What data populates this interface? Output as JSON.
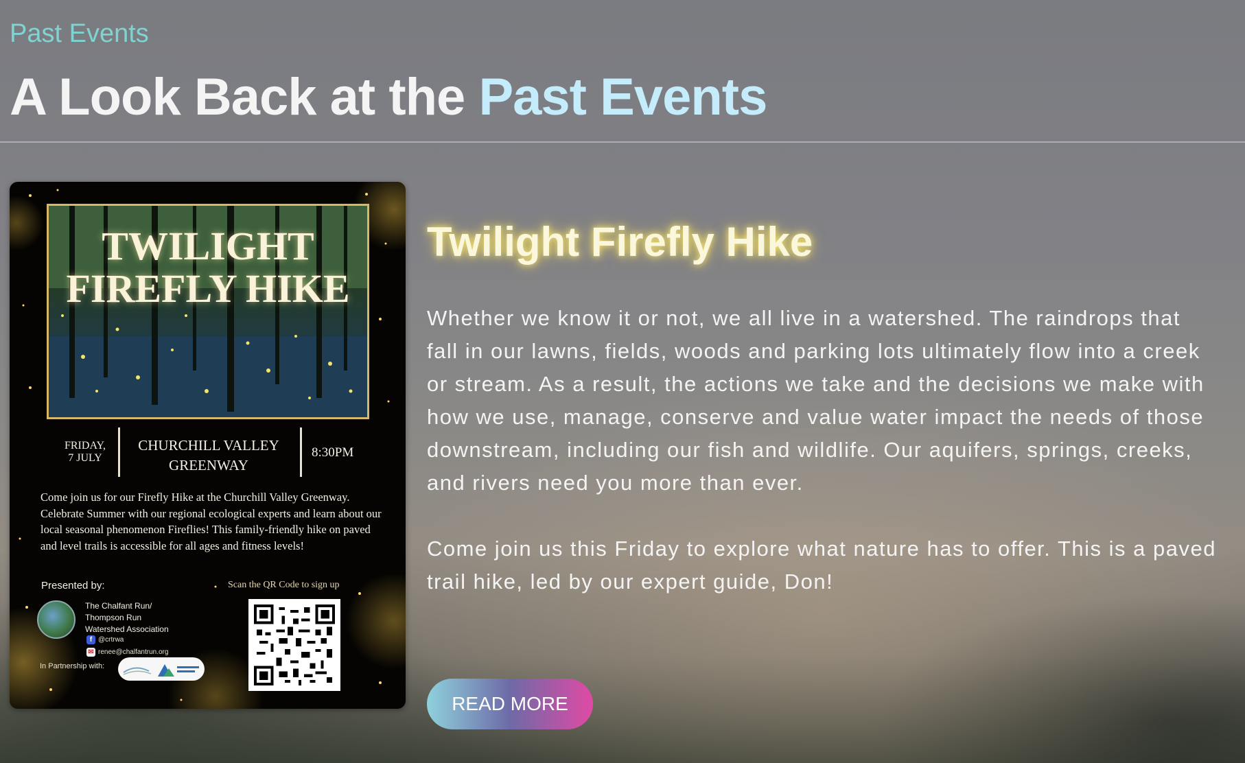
{
  "section": {
    "eyebrow": "Past Events",
    "headline_prefix": "A Look Back at the ",
    "headline_accent": "Past Events"
  },
  "event": {
    "title": "Twilight Firefly Hike",
    "paragraphs": [
      "Whether we know it or not, we all live in a watershed. The raindrops that fall in our lawns, fields, woods and parking lots ultimately flow into a creek or stream. As a result, the actions we take and the decisions we make with how we use, manage, conserve and value water impact the needs of those downstream, including our fish and wildlife. Our aquifers, springs, creeks, and rivers need you more than ever.",
      "Come join us this Friday to explore what nature has to offer. This is a paved trail hike, led by our expert guide, Don!"
    ],
    "read_more_label": "READ MORE"
  },
  "poster": {
    "title_line1": "TWILIGHT",
    "title_line2": "FIREFLY HIKE",
    "date_line1": "FRIDAY,",
    "date_line2": "7 JULY",
    "place_line1": "CHURCHILL VALLEY",
    "place_line2": "GREENWAY",
    "time": "8:30PM",
    "body": "Come join us for our Firefly Hike at the Churchill Valley Greenway. Celebrate Summer with our regional ecological experts and learn about our local seasonal phenomenon Fireflies! This family-friendly hike on paved and level trails is accessible for all ages and fitness levels!",
    "presented_by": "Presented by:",
    "scan_text": "Scan the QR Code to sign up",
    "org_line1": "The Chalfant Run/",
    "org_line2": "Thompson Run",
    "org_line3": "Watershed Association",
    "facebook": "@crtrwa",
    "email": "renee@chalfantrun.org",
    "partnership": "In Partnership with:",
    "icons": {
      "facebook": "facebook-icon",
      "email": "email-icon"
    }
  },
  "colors": {
    "eyebrow": "#7fd3d0",
    "headline_accent": "#c4ecfb",
    "title_glow": "#ffec6e",
    "button_start": "#8fd1dc",
    "button_end": "#e04aa4"
  }
}
